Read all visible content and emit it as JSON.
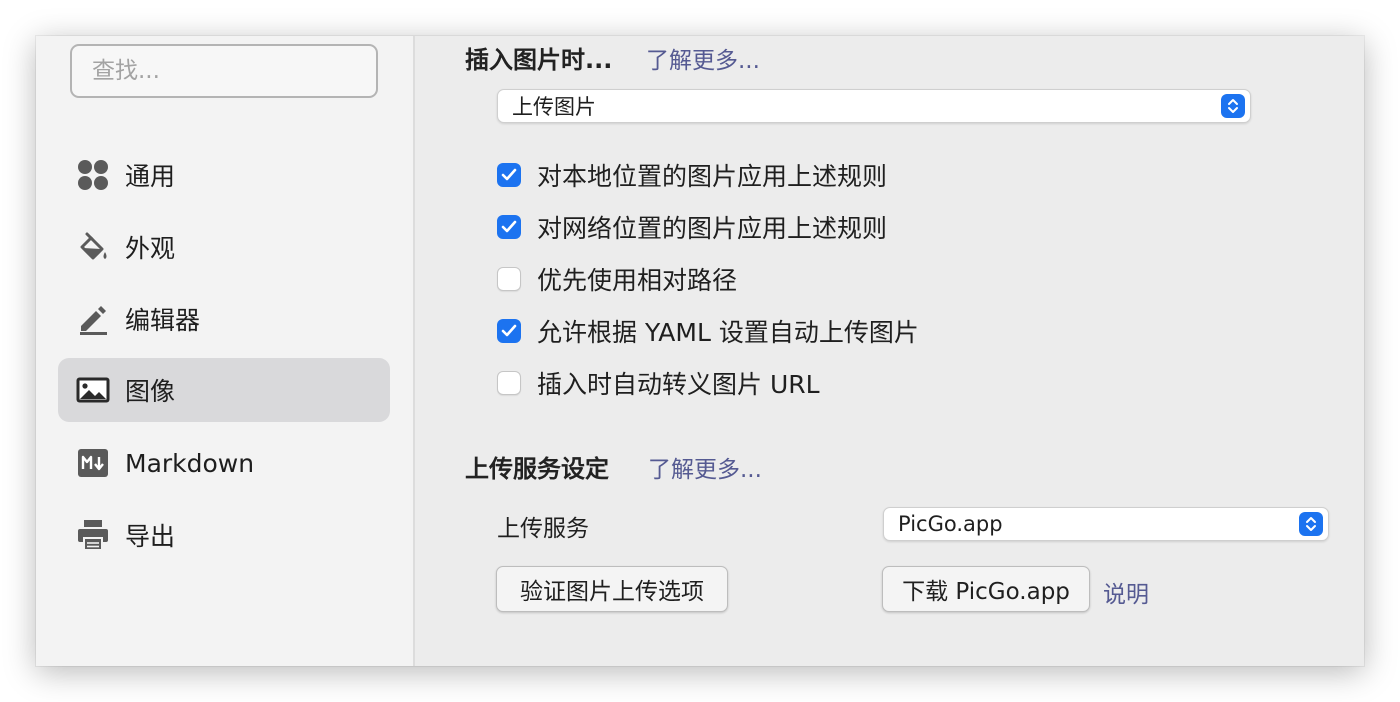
{
  "search": {
    "placeholder": "查找..."
  },
  "sidebar": {
    "items": [
      {
        "label": "通用",
        "icon": "grid-icon",
        "active": false
      },
      {
        "label": "外观",
        "icon": "paint-bucket-icon",
        "active": false
      },
      {
        "label": "编辑器",
        "icon": "pencil-icon",
        "active": false
      },
      {
        "label": "图像",
        "icon": "image-icon",
        "active": true
      },
      {
        "label": "Markdown",
        "icon": "markdown-icon",
        "active": false
      },
      {
        "label": "导出",
        "icon": "printer-icon",
        "active": false
      }
    ]
  },
  "insert_section": {
    "title": "插入图片时...",
    "learn_more": "了解更多...",
    "action_select": "上传图片",
    "options": [
      {
        "label": "对本地位置的图片应用上述规则",
        "checked": true
      },
      {
        "label": "对网络位置的图片应用上述规则",
        "checked": true
      },
      {
        "label": "优先使用相对路径",
        "checked": false
      },
      {
        "label": "允许根据 YAML 设置自动上传图片",
        "checked": true
      },
      {
        "label": "插入时自动转义图片 URL",
        "checked": false
      }
    ]
  },
  "upload_section": {
    "title": "上传服务设定",
    "learn_more": "了解更多...",
    "service_label": "上传服务",
    "service_select": "PicGo.app",
    "verify_button": "验证图片上传选项",
    "download_button": "下载 PicGo.app",
    "help_link": "说明"
  },
  "colors": {
    "accent": "#1c73f0",
    "link": "#555a92",
    "sidebar_bg": "#f3f3f3",
    "active_item_bg": "#d9d9db"
  }
}
